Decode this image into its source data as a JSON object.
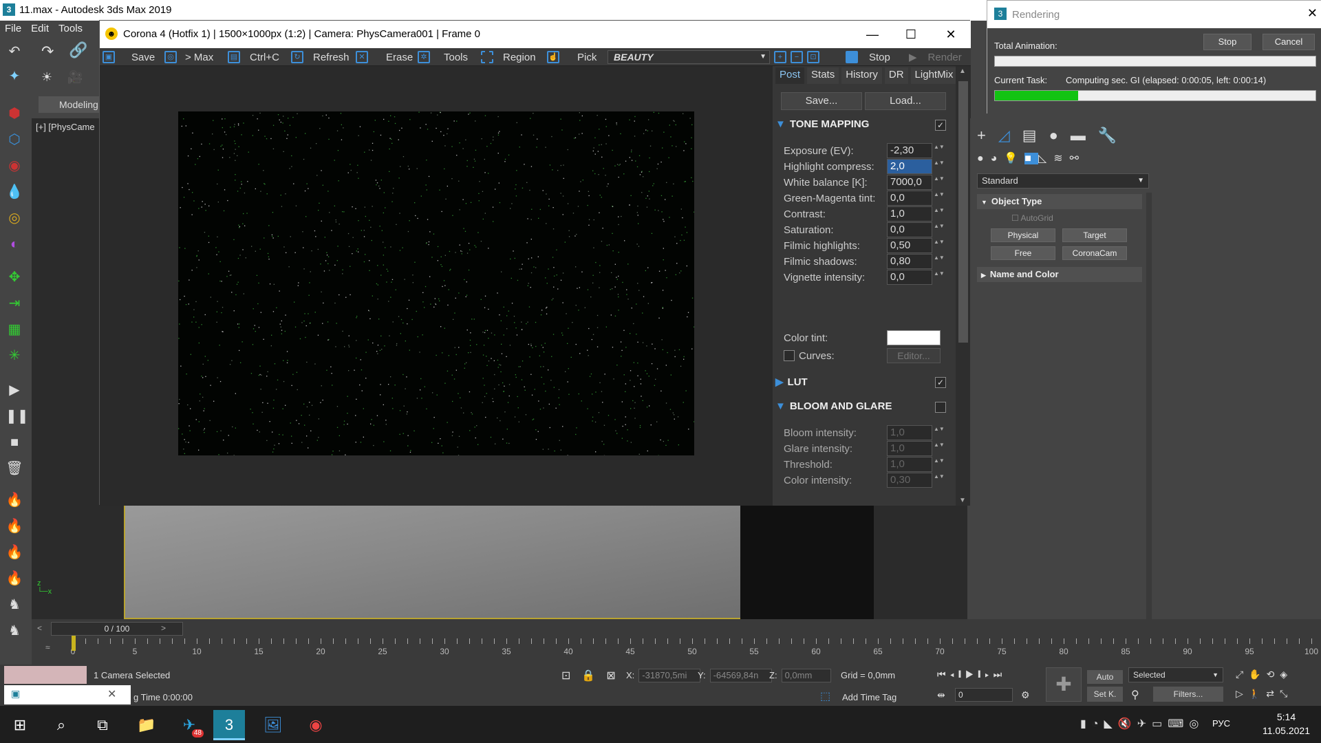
{
  "app": {
    "title": "11.max - Autodesk 3ds Max 2019",
    "icon": "3"
  },
  "menu": [
    "File",
    "Edit",
    "Tools"
  ],
  "workspace_tab": "Modeling",
  "viewport": {
    "label": "[+] [PhysCame"
  },
  "corona": {
    "title": "Corona 4 (Hotfix 1) | 1500×1000px (1:2) | Camera: PhysCamera001 | Frame 0",
    "toolbar": {
      "save": "Save",
      "to_max": "> Max",
      "ctrl_c": "Ctrl+C",
      "refresh": "Refresh",
      "erase": "Erase",
      "tools": "Tools",
      "region": "Region",
      "pick": "Pick",
      "channel": "BEAUTY",
      "stop": "Stop",
      "render": "Render"
    },
    "tabs": [
      "Post",
      "Stats",
      "History",
      "DR",
      "LightMix"
    ],
    "save_btn": "Save...",
    "load_btn": "Load...",
    "tone_mapping": {
      "title": "TONE MAPPING",
      "rows": [
        {
          "label": "Exposure (EV):",
          "value": "-2,30"
        },
        {
          "label": "Highlight compress:",
          "value": "2,0"
        },
        {
          "label": "White balance [K]:",
          "value": "7000,0"
        },
        {
          "label": "Green-Magenta tint:",
          "value": "0,0"
        },
        {
          "label": "Contrast:",
          "value": "1,0"
        },
        {
          "label": "Saturation:",
          "value": "0,0"
        },
        {
          "label": "Filmic highlights:",
          "value": "0,50"
        },
        {
          "label": "Filmic shadows:",
          "value": "0,80"
        },
        {
          "label": "Vignette intensity:",
          "value": "0,0"
        }
      ],
      "color_tint": "Color tint:",
      "curves": "Curves:",
      "editor": "Editor..."
    },
    "lut": {
      "title": "LUT"
    },
    "bloom": {
      "title": "BLOOM AND GLARE",
      "rows": [
        {
          "label": "Bloom intensity:",
          "value": "1,0"
        },
        {
          "label": "Glare intensity:",
          "value": "1,0"
        },
        {
          "label": "Threshold:",
          "value": "1,0"
        },
        {
          "label": "Color intensity:",
          "value": "0,30"
        }
      ]
    }
  },
  "rendering": {
    "title": "Rendering",
    "total_label": "Total Animation:",
    "stop": "Stop",
    "cancel": "Cancel",
    "current_label": "Current Task:",
    "current_text": "Computing sec. GI (elapsed: 0:00:05, left: 0:00:14)",
    "current_progress": 0.26,
    "total_progress": 0.0
  },
  "cmdpanel": {
    "dropdown": "Standard",
    "object_type": "Object Type",
    "autogrid": "AutoGrid",
    "buttons": [
      "Physical",
      "Target",
      "Free",
      "CoronaCam"
    ],
    "name_color": "Name and Color"
  },
  "timeline": {
    "frame": "0 / 100",
    "ticks": [
      "0",
      "5",
      "10",
      "15",
      "20",
      "25",
      "30",
      "35",
      "40",
      "45",
      "50",
      "55",
      "60",
      "65",
      "70",
      "75",
      "80",
      "85",
      "90",
      "95",
      "100"
    ]
  },
  "status": {
    "selected": "1 Camera Selected",
    "time": "g Time  0:00:00",
    "x_label": "X:",
    "x": "-31870,5mi",
    "y_label": "Y:",
    "y": "-64569,84n",
    "z_label": "Z:",
    "z": "0,0mm",
    "grid": "Grid = 0,0mm",
    "add_tag": "Add Time Tag",
    "frame_field": "0",
    "auto": "Auto",
    "selected_dd": "Selected",
    "setk": "Set K.",
    "filters": "Filters..."
  },
  "taskbar": {
    "time": "5:14",
    "date": "11.05.2021",
    "lang": "РУС",
    "badge": "48"
  }
}
